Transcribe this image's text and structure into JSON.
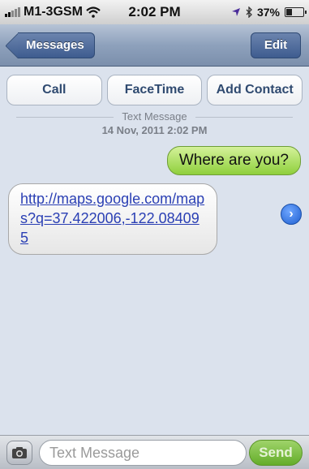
{
  "status_bar": {
    "carrier": "M1-3GSM",
    "time": "2:02 PM",
    "battery": "37%",
    "battery_level": 0.37,
    "icons": [
      "signal-icon",
      "wifi-icon",
      "location-icon",
      "bluetooth-icon",
      "battery-icon"
    ]
  },
  "nav": {
    "back_label": "Messages",
    "edit_label": "Edit"
  },
  "actions": [
    "Call",
    "FaceTime",
    "Add Contact"
  ],
  "thread": {
    "type_label": "Text Message",
    "date": "14 Nov, 2011 2:02 PM"
  },
  "messages": {
    "outgoing": "Where are you?",
    "incoming_link": "http://maps.google.com/maps?q=37.422006,-122.084095"
  },
  "composer": {
    "placeholder": "Text Message",
    "send_label": "Send"
  },
  "colors": {
    "outgoing_bubble": "#8fcf3c",
    "nav_button": "#3e5c8f",
    "link": "#2a3fb4"
  }
}
